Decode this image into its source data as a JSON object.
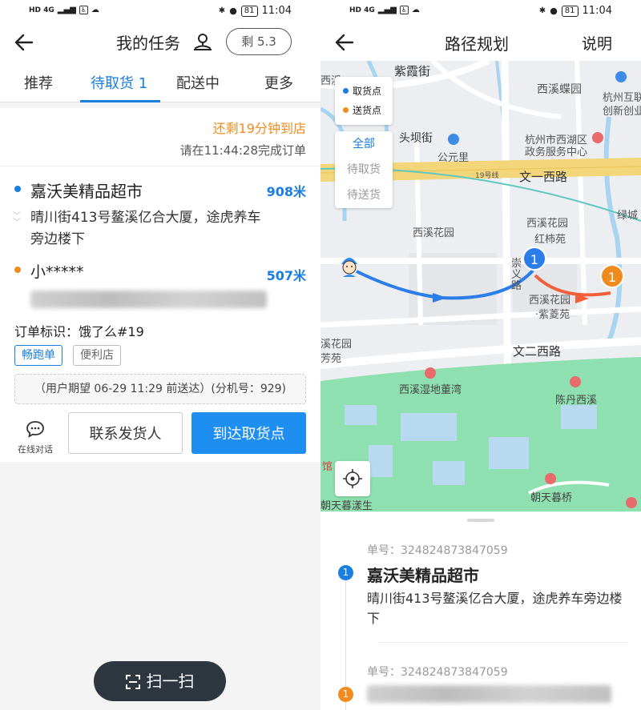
{
  "status_bar": {
    "left_icons": "HD 4G",
    "time": "11:04",
    "battery": "81"
  },
  "left": {
    "title": "我的任务",
    "remaining": "剩 5.3",
    "tabs": [
      {
        "label": "推荐"
      },
      {
        "label": "待取货 1"
      },
      {
        "label": "配送中"
      },
      {
        "label": "更多"
      }
    ],
    "countdown": "还剩19分钟到店",
    "deadline": "请在11:44:28完成订单",
    "pickup": {
      "name": "嘉沃美精品超市",
      "distance": "908米",
      "address": "晴川街413号鳌溪亿合大厦，途虎养车旁边楼下"
    },
    "dropoff": {
      "name": "小*****",
      "distance": "507米"
    },
    "order_tag": "订单标识：饿了么#19",
    "badges": [
      "畅跑单",
      "便利店"
    ],
    "expectation": "（用户期望 06-29 11:29 前送达）(分机号：929)",
    "chat_label": "在线对话",
    "contact_button": "联系发货人",
    "arrive_button": "到达取货点",
    "scan_button": "扫一扫"
  },
  "right": {
    "title": "路径规划",
    "help": "说明",
    "legend": {
      "pickup": "取货点",
      "delivery": "送货点"
    },
    "filters": [
      "全部",
      "待取货",
      "待送货"
    ],
    "map_labels": {
      "l1": "紫霞街",
      "l2": "西溪蝶园",
      "l3": "杭州互联",
      "l4": "创新创业",
      "l5": "头坝街",
      "l6": "公元里",
      "l7": "杭州市西湖区",
      "l8": "政务服务中心",
      "l9": "文一西路",
      "l10": "19号线",
      "l11": "西溪花园",
      "l12": "西溪花园",
      "l13": "红柿苑",
      "l14": "绿城",
      "l15": "崇义路",
      "l16": "西溪花园",
      "l17": "·紫菱苑",
      "l18": "溪花园",
      "l19": "芳苑",
      "l20": "文二西路",
      "l21": "西溪湿地董湾",
      "l22": "陈丹西溪",
      "l23": "朝天暮桥",
      "l24": "朝天暮漾生",
      "l25": "馆",
      "l26": "西溪"
    },
    "orders": [
      {
        "num": "1",
        "order_no": "单号：324824873847059",
        "name": "嘉沃美精品超市",
        "address": "晴川街413号鳌溪亿合大厦，途虎养车旁边楼下"
      },
      {
        "num": "1",
        "order_no": "单号：324824873847059"
      }
    ],
    "colors": {
      "pickup": "#1a7de0",
      "delivery": "#f08c1f",
      "park": "#8fe0b0",
      "road": "#f3d57a"
    }
  }
}
